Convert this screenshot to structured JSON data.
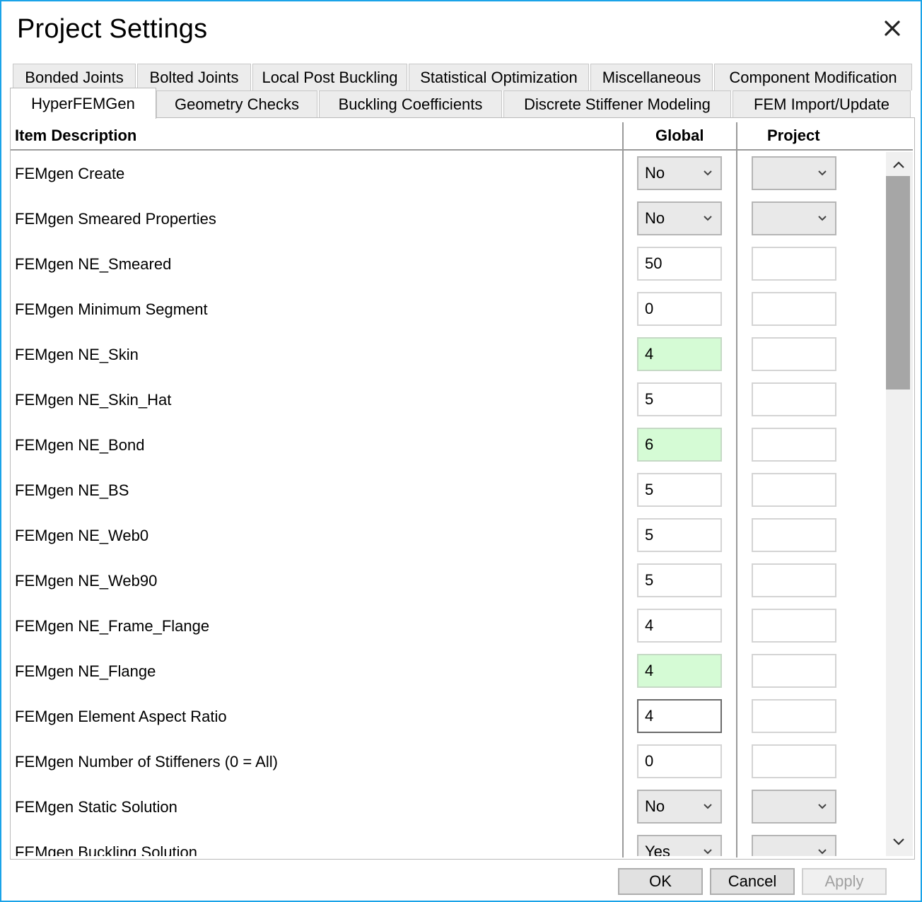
{
  "window": {
    "title": "Project Settings"
  },
  "tabs_row1": [
    {
      "label": "Bonded Joints"
    },
    {
      "label": "Bolted Joints"
    },
    {
      "label": "Local Post Buckling"
    },
    {
      "label": "Statistical Optimization"
    },
    {
      "label": "Miscellaneous"
    },
    {
      "label": "Component Modification"
    }
  ],
  "tabs_row2": [
    {
      "label": "HyperFEMGen",
      "active": true
    },
    {
      "label": "Geometry Checks"
    },
    {
      "label": "Buckling Coefficients"
    },
    {
      "label": "Discrete Stiffener Modeling"
    },
    {
      "label": "FEM Import/Update"
    }
  ],
  "table": {
    "headers": {
      "description": "Item Description",
      "global": "Global",
      "project": "Project"
    },
    "rows": [
      {
        "description": "FEMgen Create",
        "global": "No",
        "global_type": "select",
        "project": "",
        "project_type": "select"
      },
      {
        "description": "FEMgen Smeared Properties",
        "global": "No",
        "global_type": "select",
        "project": "",
        "project_type": "select"
      },
      {
        "description": "FEMgen NE_Smeared",
        "global": "50",
        "global_type": "text",
        "project": "",
        "project_type": "text"
      },
      {
        "description": "FEMgen Minimum Segment",
        "global": "0",
        "global_type": "text",
        "project": "",
        "project_type": "text"
      },
      {
        "description": "FEMgen NE_Skin",
        "global": "4",
        "global_type": "text",
        "highlight": true,
        "project": "",
        "project_type": "text"
      },
      {
        "description": "FEMgen NE_Skin_Hat",
        "global": "5",
        "global_type": "text",
        "project": "",
        "project_type": "text"
      },
      {
        "description": "FEMgen NE_Bond",
        "global": "6",
        "global_type": "text",
        "highlight": true,
        "project": "",
        "project_type": "text"
      },
      {
        "description": "FEMgen NE_BS",
        "global": "5",
        "global_type": "text",
        "project": "",
        "project_type": "text"
      },
      {
        "description": "FEMgen NE_Web0",
        "global": "5",
        "global_type": "text",
        "project": "",
        "project_type": "text"
      },
      {
        "description": "FEMgen NE_Web90",
        "global": "5",
        "global_type": "text",
        "project": "",
        "project_type": "text"
      },
      {
        "description": "FEMgen NE_Frame_Flange",
        "global": "4",
        "global_type": "text",
        "project": "",
        "project_type": "text"
      },
      {
        "description": "FEMgen NE_Flange",
        "global": "4",
        "global_type": "text",
        "highlight": true,
        "project": "",
        "project_type": "text"
      },
      {
        "description": "FEMgen Element Aspect Ratio",
        "global": "4",
        "global_type": "text",
        "focused": true,
        "project": "",
        "project_type": "text"
      },
      {
        "description": "FEMgen Number of Stiffeners (0 = All)",
        "global": "0",
        "global_type": "text",
        "project": "",
        "project_type": "text"
      },
      {
        "description": "FEMgen Static Solution",
        "global": "No",
        "global_type": "select",
        "project": "",
        "project_type": "select"
      },
      {
        "description": "FEMgen Buckling Solution",
        "global": "Yes",
        "global_type": "select",
        "project": "",
        "project_type": "select"
      }
    ]
  },
  "buttons": {
    "ok": "OK",
    "cancel": "Cancel",
    "apply": "Apply"
  },
  "icons": {
    "close": "close-icon",
    "chevron": "chevron-down-icon",
    "scroll_up": "chevron-up-icon",
    "scroll_down": "chevron-down-icon"
  },
  "colors": {
    "window_border": "#1aa3e8",
    "highlight_cell": "#d5fbd5"
  }
}
